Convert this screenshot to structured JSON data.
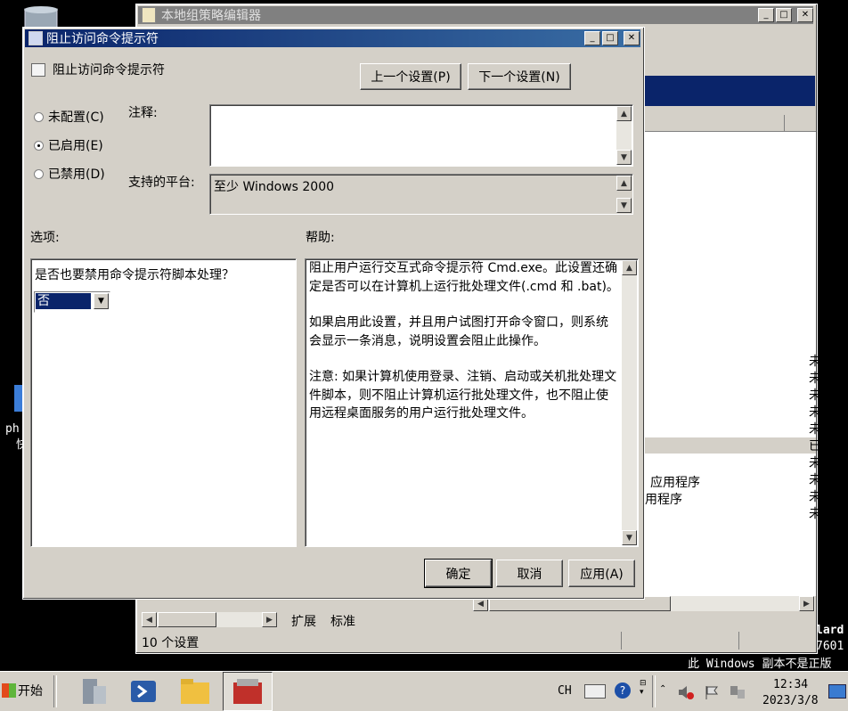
{
  "desktop": {
    "watermark": "此 Windows 副本不是正版",
    "edge_text_1": "lard",
    "edge_text_2": "7601",
    "php_label": "ph",
    "php_label_2": "快"
  },
  "back_window": {
    "title": "本地组策略编辑器",
    "status": "10 个设置",
    "tabs": [
      "扩展",
      "标准"
    ],
    "rows": [
      "应用程序",
      "用程序"
    ],
    "col_chars": [
      "未",
      "未",
      "未",
      "未",
      "未",
      "已",
      "未",
      "未",
      "未",
      "未"
    ]
  },
  "dialog": {
    "title": "阻止访问命令提示符",
    "setting_name": "阻止访问命令提示符",
    "prev_button": "上一个设置(P)",
    "next_button": "下一个设置(N)",
    "radio_not_configured": "未配置(C)",
    "radio_enabled": "已启用(E)",
    "radio_disabled": "已禁用(D)",
    "selected_state": "已启用(E)",
    "comment_label": "注释:",
    "comment_value": "",
    "platform_label": "支持的平台:",
    "platform_value": "至少 Windows 2000",
    "options_label": "选项:",
    "help_label": "帮助:",
    "option_question": "是否也要禁用命令提示符脚本处理？",
    "option_select_value": "否",
    "help_text": [
      "阻止用户运行交互式命令提示符 Cmd.exe。此设置还确定是否可以在计算机上运行批处理文件(.cmd 和 .bat)。",
      "如果启用此设置，并且用户试图打开命令窗口，则系统会显示一条消息，说明设置会阻止此操作。",
      "注意: 如果计算机使用登录、注销、启动或关机批处理文件脚本，则不阻止计算机运行批处理文件，也不阻止使用远程桌面服务的用户运行批处理文件。"
    ],
    "ok_button": "确定",
    "cancel_button": "取消",
    "apply_button": "应用(A)"
  },
  "taskbar": {
    "start_label": "开始",
    "lang": "CH",
    "time": "12:34",
    "date": "2023/3/8"
  },
  "icons": [
    "recycle-bin-icon",
    "server-manager-icon",
    "powershell-icon",
    "explorer-folder-icon",
    "gpedit-icon",
    "keyboard-icon",
    "help-icon",
    "speaker-muted-icon",
    "flag-icon",
    "network-icon"
  ]
}
